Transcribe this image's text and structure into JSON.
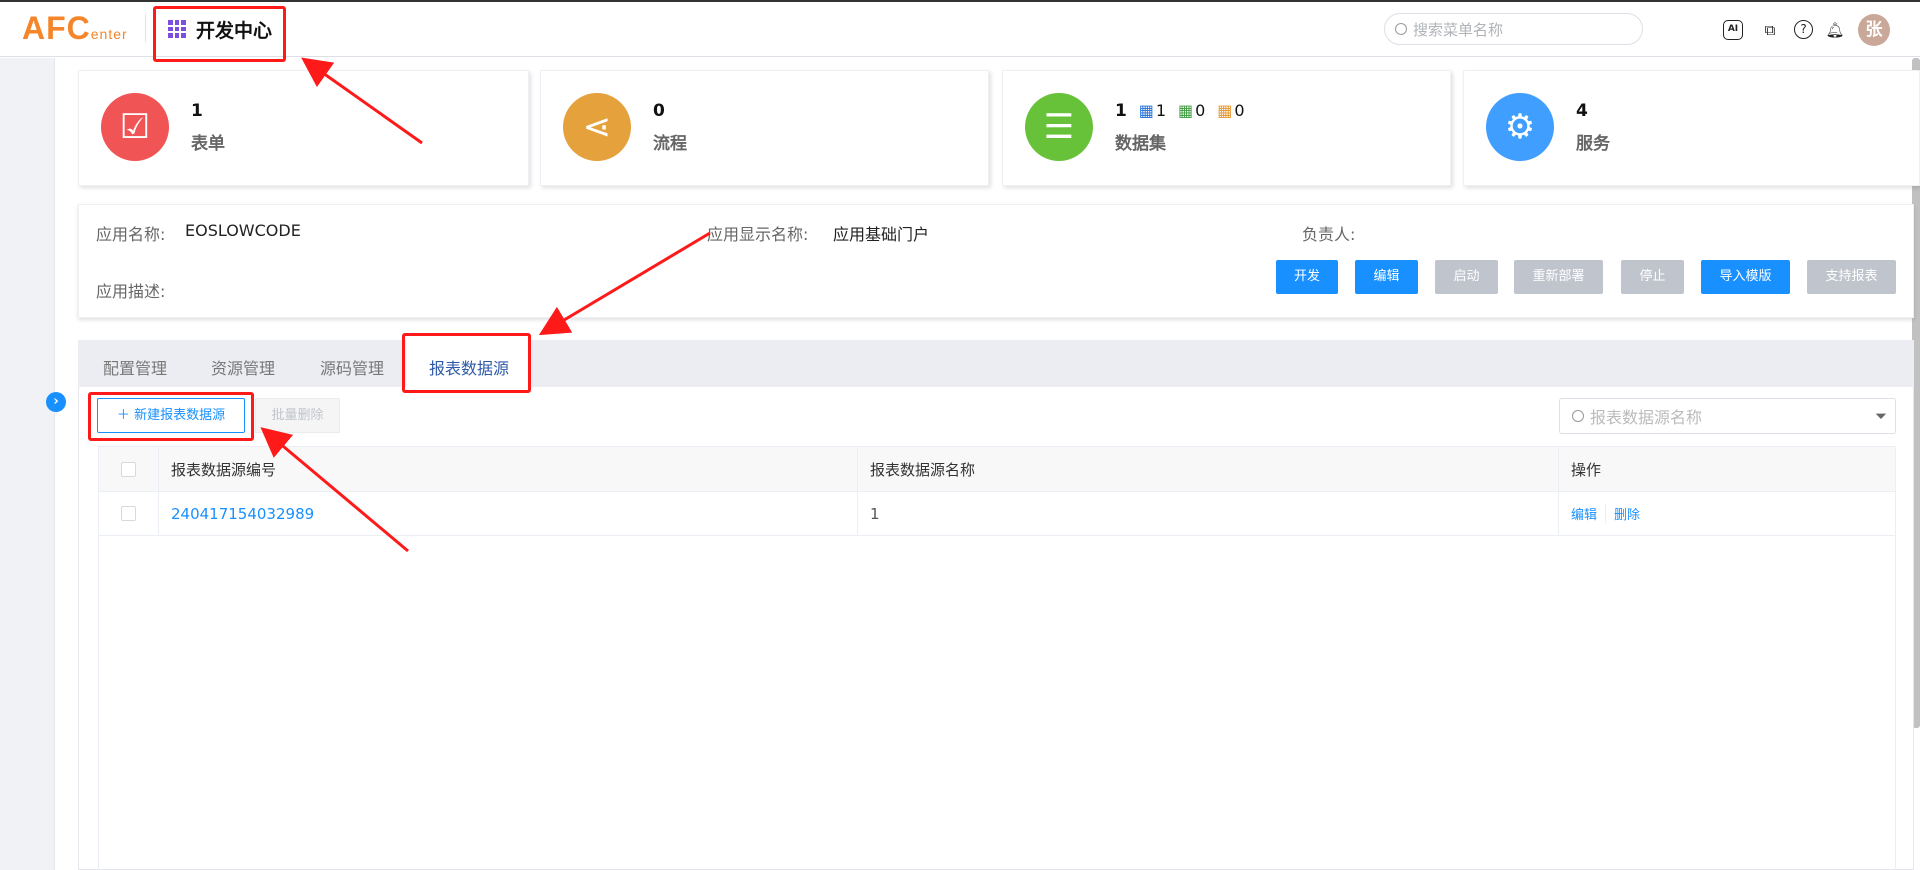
{
  "header": {
    "logo_main": "AFC",
    "logo_sub": "enter",
    "app_title": "开发中心",
    "search_placeholder": "搜索菜单名称",
    "icons": [
      "ai-icon",
      "puzzle-icon",
      "help-icon",
      "bell-icon"
    ],
    "avatar": "张"
  },
  "stats": [
    {
      "count": "1",
      "label": "表单",
      "icon": "form-check-icon",
      "color": "#f05454"
    },
    {
      "count": "0",
      "label": "流程",
      "icon": "share-icon",
      "color": "#e5a13c"
    },
    {
      "count": "1",
      "label": "数据集",
      "icon": "table-icon",
      "color": "#67c23a",
      "sub_counts": [
        "1",
        "0",
        "0"
      ]
    },
    {
      "count": "4",
      "label": "服务",
      "icon": "gear-icon",
      "color": "#409eff"
    }
  ],
  "info": {
    "name_label": "应用名称:",
    "name_value": "EOSLOWCODE",
    "display_label": "应用显示名称:",
    "display_value": "应用基础门户",
    "owner_label": "负责人:",
    "desc_label": "应用描述:",
    "buttons": [
      {
        "label": "开发",
        "enabled": true
      },
      {
        "label": "编辑",
        "enabled": true
      },
      {
        "label": "启动",
        "enabled": false
      },
      {
        "label": "重新部署",
        "enabled": false
      },
      {
        "label": "停止",
        "enabled": false
      },
      {
        "label": "导入模版",
        "enabled": true
      },
      {
        "label": "支持报表",
        "enabled": false
      }
    ]
  },
  "tabs": [
    {
      "label": "配置管理"
    },
    {
      "label": "资源管理"
    },
    {
      "label": "源码管理"
    },
    {
      "label": "报表数据源",
      "active": true
    }
  ],
  "toolbar": {
    "new_label": "新建报表数据源",
    "batch_delete_label": "批量删除",
    "search_placeholder": "报表数据源名称"
  },
  "table": {
    "columns": [
      "报表数据源编号",
      "报表数据源名称",
      "操作"
    ],
    "rows": [
      {
        "code": "240417154032989",
        "name": "1",
        "actions": [
          "编辑",
          "删除"
        ]
      }
    ]
  },
  "colors": {
    "primary": "#1890ff",
    "annotation": "#ff1a1a"
  }
}
